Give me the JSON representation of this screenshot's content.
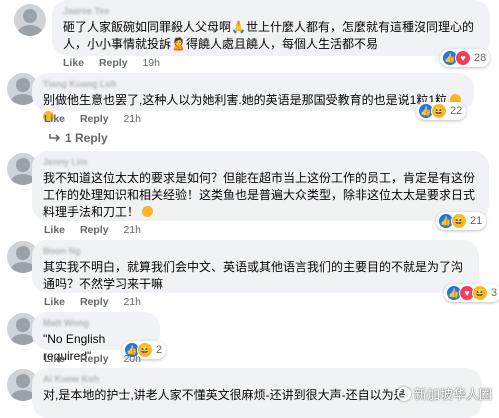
{
  "comments": [
    {
      "author": "Jaaroe Tee",
      "text": "砸了人家飯碗如同罪殺人父母啊🙏世上什麼人都有，怎麼就有這種沒同理心的人，小小事情就投訴🙎得饒人處且饒人，每個人生活都不易",
      "actions": {
        "like": "Like",
        "reply": "Reply",
        "time": "19h"
      },
      "reactions": {
        "types": [
          "like",
          "love"
        ],
        "count": "28"
      }
    },
    {
      "author": "Tiang Kuang Loh",
      "text": "别做他生意也罢了,这种人以为她利害.她的英语是那国受教育的也是说1粒1粒",
      "actions": {
        "like": "Like",
        "reply": "Reply",
        "time": "21h"
      },
      "reactions": {
        "types": [
          "like",
          "haha"
        ],
        "count": "22"
      },
      "replies_link": "1 Reply"
    },
    {
      "author": "Jenny Lim",
      "text": "我不知道这位太太的要求是如何？但能在超市当上这份工作的员工，肯定是有这份工作的处理知识和相关经验！这类鱼也是普遍大众类型，除非这位太太是要求日式料理手法和刀工！",
      "actions": {
        "like": "Like",
        "reply": "Reply",
        "time": "21h"
      },
      "reactions": {
        "types": [
          "like",
          "haha"
        ],
        "count": "21"
      }
    },
    {
      "author": "Boon Ng",
      "text": "其实我不明白，就算我们会中文、英语或其他语言我们的主要目的不就是为了沟通吗？不然学习来干嘛",
      "actions": {
        "like": "Like",
        "reply": "Reply",
        "time": "21h"
      },
      "reactions": {
        "types": [
          "like",
          "love",
          "haha"
        ],
        "count": "3"
      }
    },
    {
      "author": "Matt Wong",
      "text": "\"No English required\"",
      "actions": {
        "like": "Like",
        "reply": "Reply",
        "time": "20h"
      },
      "reactions": {
        "types": [
          "like",
          "haha"
        ],
        "count": "2"
      }
    },
    {
      "author": "Ai Kuow Koh",
      "text": "对,是本地的护士,讲老人家不懂英文很麻烦-还讲到很大声-还自以为是"
    }
  ],
  "watermark": "新加坡华人圈",
  "colors": {
    "bubble": "#f0f2f5",
    "meta": "#65676b",
    "like": "#1877f2",
    "love": "#f33e58",
    "haha": "#f7b928"
  }
}
